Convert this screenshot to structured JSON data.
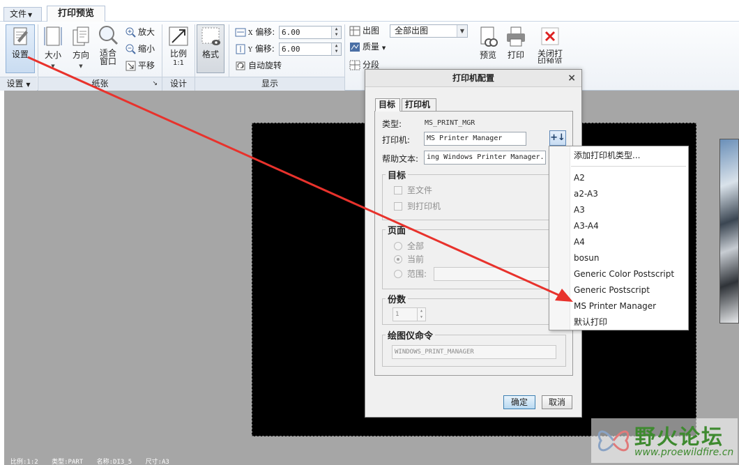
{
  "menu": {
    "file_label": "文件",
    "active_tab": "打印预览"
  },
  "ribbon": {
    "setup_label": "设置",
    "size_label": "大小",
    "orientation_label": "方向",
    "fit_label_line1": "适合",
    "fit_label_line2": "窗口",
    "zoom_in_label": "放大",
    "zoom_out_label": "缩小",
    "pan_label": "平移",
    "scale_label": "比例",
    "scale_value": "1:1",
    "format_label": "格式",
    "x_offset_label": "偏移:",
    "x_axis": "X",
    "x_offset_value": "6.00",
    "y_offset_label": "偏移:",
    "y_axis": "Y",
    "y_offset_value": "6.00",
    "auto_rotate_label": "自动旋转",
    "output_label": "出图",
    "output_combo_value": "全部出图",
    "quality_label": "质量",
    "segment_label": "分段",
    "preview_label": "预览",
    "print_label": "打印",
    "close_line1": "关闭打",
    "close_line2": "印预览",
    "groups": {
      "setup": "设置",
      "paper": "纸张",
      "design": "设计",
      "display": "显示"
    }
  },
  "dialog": {
    "title": "打印机配置",
    "tab_target": "目标",
    "tab_printer": "打印机",
    "type_label": "类型:",
    "type_value": "MS_PRINT_MGR",
    "printer_label": "打印机:",
    "printer_value": "MS Printer Manager",
    "help_label": "帮助文本:",
    "help_value": "ing Windows Printer Manager.",
    "target_group": "目标",
    "to_file": "至文件",
    "to_printer": "到打印机",
    "pages_group": "页面",
    "pages_all": "全部",
    "pages_current": "当前",
    "pages_range": "范围:",
    "copies_group": "份数",
    "copies_value": "1",
    "plotter_group": "绘图仪命令",
    "plotter_value": "WINDOWS_PRINT_MANAGER",
    "ok_label": "确定",
    "cancel_label": "取消"
  },
  "dropdown": {
    "add_type": "添加打印机类型...",
    "items": [
      "A2",
      "a2-A3",
      "A3",
      "A3-A4",
      "A4",
      "bosun",
      "Generic Color Postscript",
      "Generic Postscript",
      "MS Printer Manager",
      "默认打印"
    ]
  },
  "status": {
    "scale": "比例:1:2",
    "type": "类型:PART",
    "name": "名称:DI3_5",
    "size": "尺寸:A3"
  },
  "watermark": {
    "text": "野火论坛",
    "url": "www.proewildfire.cn"
  },
  "colors": {
    "arrow": "#e8322c",
    "watermark": "#3e8a2f",
    "paper": "#000000",
    "workspace": "#a6a6a6"
  }
}
